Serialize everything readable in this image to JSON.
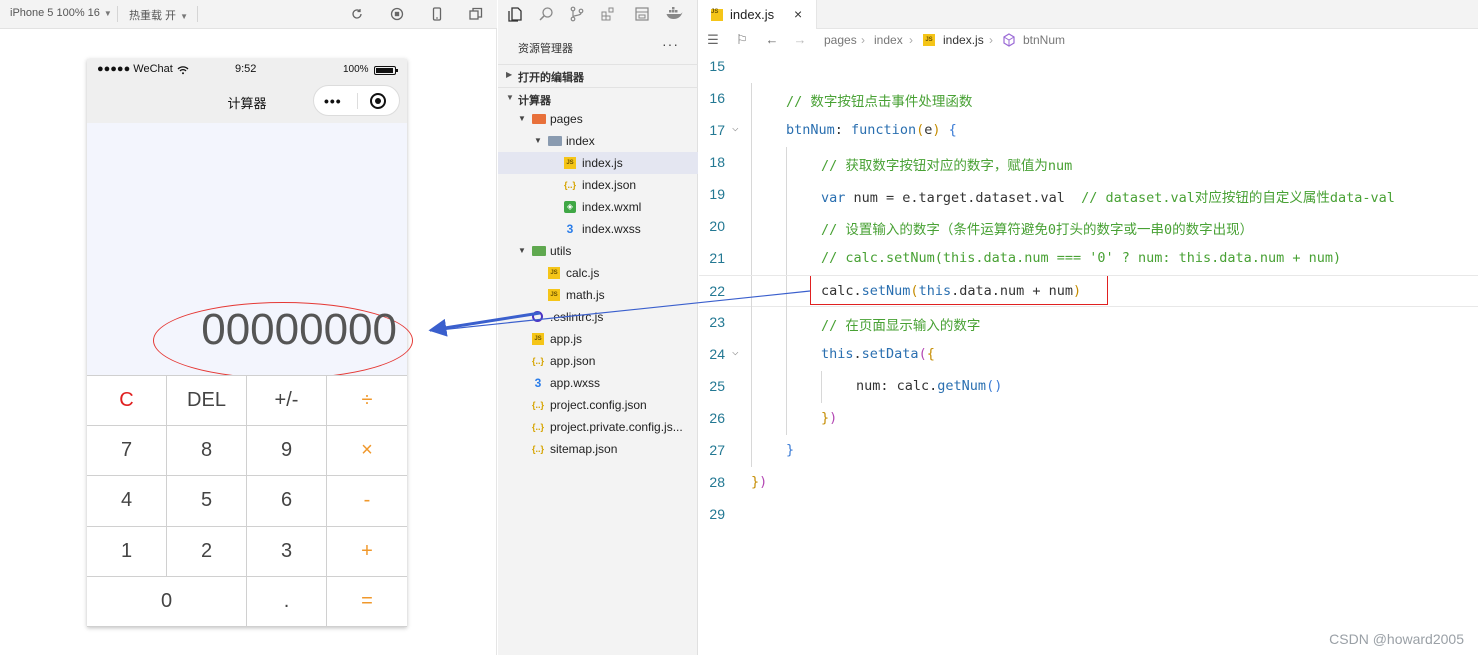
{
  "simulator": {
    "device_label": "iPhone 5 100% 16",
    "reload_label": "热重载 开",
    "status": {
      "carrier": "●●●●● WeChat",
      "time": "9:52",
      "battery": "100%"
    },
    "nav_title": "计算器",
    "capsule_dots": "•••",
    "display": "00000000",
    "keys": [
      {
        "label": "C",
        "style": "red"
      },
      {
        "label": "DEL",
        "style": ""
      },
      {
        "label": "+/-",
        "style": ""
      },
      {
        "label": "÷",
        "style": "op"
      },
      {
        "label": "7",
        "style": ""
      },
      {
        "label": "8",
        "style": ""
      },
      {
        "label": "9",
        "style": ""
      },
      {
        "label": "×",
        "style": "op"
      },
      {
        "label": "4",
        "style": ""
      },
      {
        "label": "5",
        "style": ""
      },
      {
        "label": "6",
        "style": ""
      },
      {
        "label": "-",
        "style": "op"
      },
      {
        "label": "1",
        "style": ""
      },
      {
        "label": "2",
        "style": ""
      },
      {
        "label": "3",
        "style": ""
      },
      {
        "label": "+",
        "style": "op"
      },
      {
        "label": "0",
        "style": ""
      },
      {
        "label": ".",
        "style": ""
      },
      {
        "label": "=",
        "style": "op"
      }
    ]
  },
  "explorer": {
    "header": "资源管理器",
    "more": "···",
    "open_editors": "打开的编辑器",
    "project": "计算器",
    "tree": [
      {
        "name": "pages",
        "icon": "folder",
        "depth": 1,
        "twisty": "▼"
      },
      {
        "name": "index",
        "icon": "folder-blue",
        "depth": 2,
        "twisty": "▼"
      },
      {
        "name": "index.js",
        "icon": "js",
        "depth": 3,
        "selected": true
      },
      {
        "name": "index.json",
        "icon": "json",
        "depth": 3
      },
      {
        "name": "index.wxml",
        "icon": "wxml",
        "depth": 3
      },
      {
        "name": "index.wxss",
        "icon": "wxss",
        "depth": 3
      },
      {
        "name": "utils",
        "icon": "folder-green",
        "depth": 1,
        "twisty": "▼"
      },
      {
        "name": "calc.js",
        "icon": "js",
        "depth": 2
      },
      {
        "name": "math.js",
        "icon": "js",
        "depth": 2
      },
      {
        "name": ".eslintrc.js",
        "icon": "eslint",
        "depth": 1
      },
      {
        "name": "app.js",
        "icon": "js",
        "depth": 1
      },
      {
        "name": "app.json",
        "icon": "json",
        "depth": 1
      },
      {
        "name": "app.wxss",
        "icon": "wxss",
        "depth": 1
      },
      {
        "name": "project.config.json",
        "icon": "json",
        "depth": 1
      },
      {
        "name": "project.private.config.js...",
        "icon": "json",
        "depth": 1
      },
      {
        "name": "sitemap.json",
        "icon": "json",
        "depth": 1
      }
    ]
  },
  "editor": {
    "tab": {
      "label": "index.js",
      "close": "×"
    },
    "breadcrumbs": [
      "pages",
      "index",
      "index.js",
      "btnNum"
    ],
    "lines": [
      {
        "n": "15",
        "indent": 0,
        "tokens": []
      },
      {
        "n": "16",
        "indent": 1,
        "tokens": [
          [
            "c-comment",
            "// 数字按钮点击事件处理函数"
          ]
        ]
      },
      {
        "n": "17",
        "indent": 1,
        "fold": true,
        "tokens": [
          [
            "c-prop",
            "btnNum"
          ],
          [
            "c-plain",
            ": "
          ],
          [
            "c-keyword",
            "function"
          ],
          [
            "c-paren",
            "("
          ],
          [
            "c-plain",
            "e"
          ],
          [
            "c-paren",
            ")"
          ],
          [
            "c-plain",
            " "
          ],
          [
            "c-paren3",
            "{"
          ]
        ]
      },
      {
        "n": "18",
        "indent": 2,
        "tokens": [
          [
            "c-comment",
            "// 获取数字按钮对应的数字，赋值为num"
          ]
        ]
      },
      {
        "n": "19",
        "indent": 2,
        "tokens": [
          [
            "c-keyword",
            "var"
          ],
          [
            "c-plain",
            " num = e.target.dataset.val  "
          ],
          [
            "c-comment",
            "// dataset.val对应按钮的自定义属性data-val"
          ]
        ]
      },
      {
        "n": "20",
        "indent": 2,
        "tokens": [
          [
            "c-comment",
            "// 设置输入的数字（条件运算符避免0打头的数字或一串0的数字出现）"
          ]
        ]
      },
      {
        "n": "21",
        "indent": 2,
        "tokens": [
          [
            "c-comment",
            "// calc.setNum(this.data.num === '0' ? num: this.data.num + num)"
          ]
        ]
      },
      {
        "n": "22",
        "indent": 2,
        "current": true,
        "tokens": [
          [
            "c-plain",
            "calc."
          ],
          [
            "c-func",
            "setNum"
          ],
          [
            "c-paren",
            "("
          ],
          [
            "c-keyword",
            "this"
          ],
          [
            "c-plain",
            ".data.num + num"
          ],
          [
            "c-paren",
            ")"
          ]
        ]
      },
      {
        "n": "23",
        "indent": 2,
        "tokens": [
          [
            "c-comment",
            "// 在页面显示输入的数字"
          ]
        ]
      },
      {
        "n": "24",
        "indent": 2,
        "fold": true,
        "tokens": [
          [
            "c-keyword",
            "this"
          ],
          [
            "c-plain",
            "."
          ],
          [
            "c-func",
            "setData"
          ],
          [
            "c-paren2",
            "("
          ],
          [
            "c-paren",
            "{"
          ]
        ]
      },
      {
        "n": "25",
        "indent": 3,
        "tokens": [
          [
            "c-plain",
            "num: calc."
          ],
          [
            "c-func",
            "getNum"
          ],
          [
            "c-paren3",
            "()"
          ]
        ]
      },
      {
        "n": "26",
        "indent": 2,
        "tokens": [
          [
            "c-paren",
            "}"
          ],
          [
            "c-paren2",
            ")"
          ]
        ]
      },
      {
        "n": "27",
        "indent": 1,
        "tokens": [
          [
            "c-paren3",
            "}"
          ]
        ]
      },
      {
        "n": "28",
        "indent": 0,
        "tokens": [
          [
            "c-paren",
            "}"
          ],
          [
            "c-paren2",
            ")"
          ]
        ]
      },
      {
        "n": "29",
        "indent": 0,
        "tokens": []
      }
    ]
  },
  "watermark": "CSDN @howard2005",
  "colors": {
    "accent_red": "#e02020",
    "operator_orange": "#f0982b",
    "arrow_blue": "#3a5fcd",
    "comment_green": "#48a134"
  }
}
